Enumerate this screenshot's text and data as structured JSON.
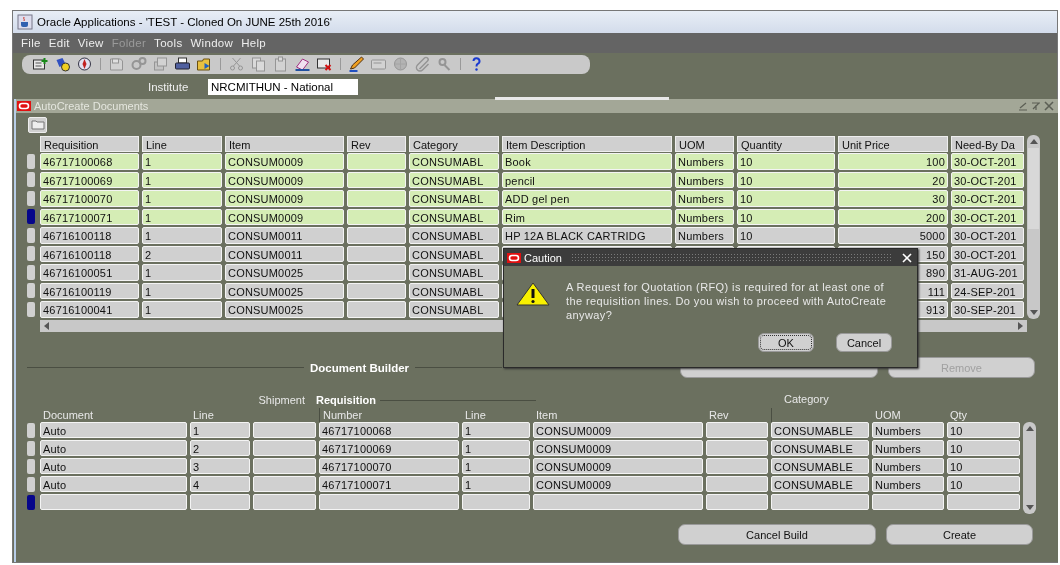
{
  "window": {
    "title": "Oracle Applications - 'TEST - Cloned On JUNE  25th 2016'"
  },
  "menu": [
    {
      "label": "File",
      "disabled": false
    },
    {
      "label": "Edit",
      "disabled": false
    },
    {
      "label": "View",
      "disabled": false
    },
    {
      "label": "Folder",
      "disabled": true
    },
    {
      "label": "Tools",
      "disabled": false
    },
    {
      "label": "Window",
      "disabled": false
    },
    {
      "label": "Help",
      "disabled": false
    }
  ],
  "toolbar": {
    "groups": [
      {
        "buttons": [
          {
            "disabled": false
          },
          {
            "disabled": false
          },
          {
            "disabled": false
          }
        ]
      },
      {
        "buttons": [
          {
            "disabled": true
          },
          {
            "disabled": true
          },
          {
            "disabled": true
          },
          {
            "disabled": false
          },
          {
            "disabled": false
          }
        ]
      },
      {
        "buttons": [
          {
            "disabled": true
          },
          {
            "disabled": true
          },
          {
            "disabled": true
          },
          {
            "disabled": false
          },
          {
            "disabled": false
          }
        ]
      },
      {
        "buttons": [
          {
            "disabled": false
          },
          {
            "disabled": true
          },
          {
            "disabled": true
          },
          {
            "disabled": true
          },
          {
            "disabled": true
          }
        ]
      },
      {
        "buttons": [
          {
            "disabled": false
          }
        ]
      }
    ]
  },
  "institute": {
    "label": "Institute",
    "value": "NRCMITHUN - National"
  },
  "autocreate": {
    "title": "AutoCreate Documents",
    "table": {
      "columns": [
        "Requisition",
        "Line",
        "Item",
        "Rev",
        "Category",
        "Item Description",
        "UOM",
        "Quantity",
        "Unit Price",
        "Need-By Da"
      ],
      "rows": [
        {
          "selected": true,
          "current": false,
          "cells": [
            "46717100068",
            "1",
            "CONSUM0009",
            null,
            "CONSUMABL",
            "Book",
            "Numbers",
            "10",
            "100",
            "30-OCT-201"
          ]
        },
        {
          "selected": true,
          "current": false,
          "cells": [
            "46717100069",
            "1",
            "CONSUM0009",
            null,
            "CONSUMABL",
            "pencil",
            "Numbers",
            "10",
            "20",
            "30-OCT-201"
          ]
        },
        {
          "selected": true,
          "current": false,
          "cells": [
            "46717100070",
            "1",
            "CONSUM0009",
            null,
            "CONSUMABL",
            "ADD gel pen",
            "Numbers",
            "10",
            "30",
            "30-OCT-201"
          ]
        },
        {
          "selected": true,
          "current": true,
          "cells": [
            "46717100071",
            "1",
            "CONSUM0009",
            null,
            "CONSUMABL",
            "Rim",
            "Numbers",
            "10",
            "200",
            "30-OCT-201"
          ]
        },
        {
          "selected": false,
          "current": false,
          "cells": [
            "46716100118",
            "1",
            "CONSUM0011",
            null,
            "CONSUMABL",
            "HP 12A BLACK CARTRIDG",
            "Numbers",
            "10",
            "5000",
            "30-OCT-201"
          ]
        },
        {
          "selected": false,
          "current": false,
          "cells": [
            "46716100118",
            "2",
            "CONSUM0011",
            null,
            "CONSUMABL",
            null,
            null,
            null,
            "150",
            "30-OCT-201"
          ]
        },
        {
          "selected": false,
          "current": false,
          "cells": [
            "46716100051",
            "1",
            "CONSUM0025",
            null,
            "CONSUMABL",
            null,
            null,
            null,
            "890",
            "31-AUG-201"
          ]
        },
        {
          "selected": false,
          "current": false,
          "cells": [
            "46716100119",
            "1",
            "CONSUM0025",
            null,
            "CONSUMABL",
            null,
            null,
            null,
            "111",
            "24-SEP-201"
          ]
        },
        {
          "selected": false,
          "current": false,
          "cells": [
            "46716100041",
            "1",
            "CONSUM0025",
            null,
            "CONSUMABL",
            null,
            null,
            null,
            "913",
            "30-SEP-201"
          ]
        }
      ]
    },
    "builder": {
      "title": "Document Builder",
      "remove_button": {
        "label": "Remove",
        "disabled": true
      },
      "groups": [
        {
          "label": "Shipment",
          "selected": false
        },
        {
          "label": "Requisition",
          "selected": true
        }
      ],
      "columns": [
        "Document",
        "Line",
        null,
        "Number",
        "Line",
        "Item",
        "Rev",
        "Category",
        "UOM",
        "Qty"
      ],
      "rows": [
        {
          "current": false,
          "cells": [
            "Auto",
            "1",
            null,
            "46717100068",
            "1",
            "CONSUM0009",
            null,
            "CONSUMABLE",
            "Numbers",
            "10"
          ]
        },
        {
          "current": false,
          "cells": [
            "Auto",
            "2",
            null,
            "46717100069",
            "1",
            "CONSUM0009",
            null,
            "CONSUMABLE",
            "Numbers",
            "10"
          ]
        },
        {
          "current": false,
          "cells": [
            "Auto",
            "3",
            null,
            "46717100070",
            "1",
            "CONSUM0009",
            null,
            "CONSUMABLE",
            "Numbers",
            "10"
          ]
        },
        {
          "current": false,
          "cells": [
            "Auto",
            "4",
            null,
            "46717100071",
            "1",
            "CONSUM0009",
            null,
            "CONSUMABLE",
            "Numbers",
            "10"
          ]
        },
        {
          "current": true,
          "cells": [
            null,
            null,
            null,
            null,
            null,
            null,
            null,
            null,
            null,
            null
          ]
        }
      ],
      "buttons": [
        {
          "label": "Cancel Build"
        },
        {
          "label": "Create"
        }
      ]
    }
  },
  "dialog": {
    "title": "Caution",
    "message": "A Request for Quotation (RFQ) is required for at least one of the requisition lines. Do you wish to proceed with AutoCreate anyway?",
    "buttons": [
      {
        "label": "OK",
        "selected": true
      },
      {
        "label": "Cancel",
        "selected": false
      }
    ]
  }
}
